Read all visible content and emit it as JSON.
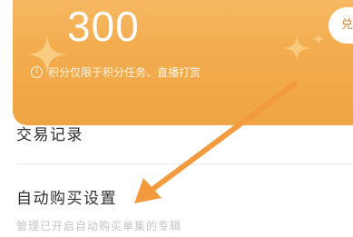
{
  "points_card": {
    "points_value": "300",
    "redeem_label": "兑",
    "notice_text": "积分仅限于积分任务、直播打赏",
    "info_icon": "info-icon"
  },
  "list": {
    "transaction_record": {
      "title": "交易记录"
    },
    "auto_purchase": {
      "title": "自动购买设置",
      "subtitle": "管理已开启自动购买单集的专辑"
    }
  },
  "annotation": {
    "type": "arrow",
    "color": "#f39a3e"
  },
  "colors": {
    "card_gradient_top": "#f7bd6a",
    "card_gradient_bottom": "#efa443",
    "title_text": "#2d2d2d",
    "subtitle_text": "#c4c4c4"
  }
}
